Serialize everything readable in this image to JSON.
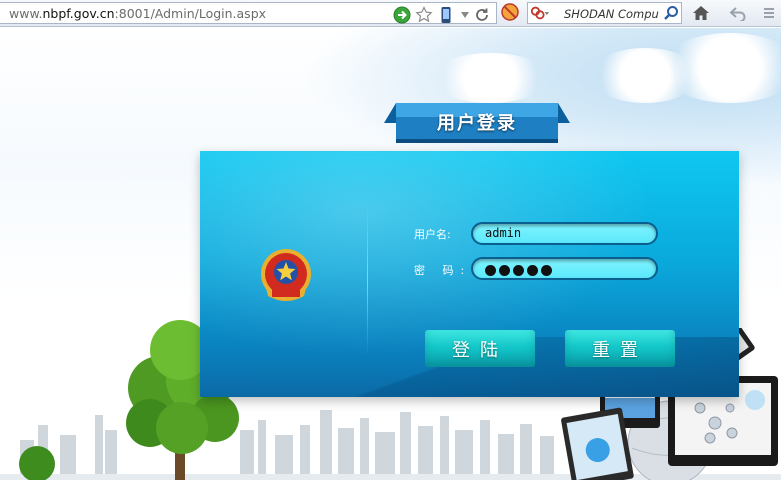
{
  "browser": {
    "url_prefix": "www.",
    "url_host": "nbpf.gov.cn",
    "url_rest": ":8001/Admin/Login.aspx",
    "search_placeholder": "SHODAN Compu"
  },
  "login": {
    "title": "用户登录",
    "username_label": "用户名:",
    "password_label": "密 码:",
    "username_value": "admin",
    "password_dot_count": 5,
    "login_button": "登陆",
    "reset_button": "重置"
  },
  "colors": {
    "panel_top": "#0fc8f1",
    "panel_bottom": "#0b6aa6",
    "input_fill": "#7ff4ff",
    "button_fill": "#13c7c8",
    "title_tab": "#1e7fc2"
  }
}
